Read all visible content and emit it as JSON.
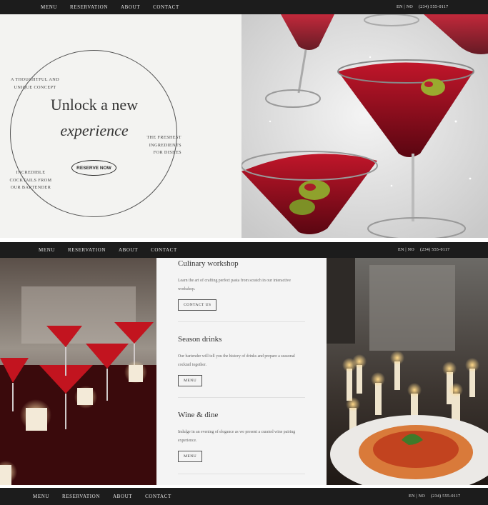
{
  "nav": {
    "items": [
      "MENU",
      "RESERVATION",
      "ABOUT",
      "CONTACT"
    ],
    "lang": "EN | NO",
    "phone": "(234) 555-0117"
  },
  "hero": {
    "title_line1": "Unlock a new",
    "title_line2": "experience",
    "concept_text": "A THOUGHTFUL AND UNIQUE CONCEPT",
    "ingredients_text": "THE FRESHEST INGREDIENTS FOR DISHES",
    "cocktails_text": "INCREDIBLE COCKTAILS FROM OUR BARTENDER",
    "reserve_label": "RESERVE NOW"
  },
  "services": [
    {
      "title": "Culinary workshop",
      "desc": "Learn the art of crafting perfect pasta from scratch in our interactive workshop.",
      "button": "CONTACT US"
    },
    {
      "title": "Season drinks",
      "desc": "Our bartender will tell you the history of drinks and prepare a seasonal cocktail together.",
      "button": "MENU"
    },
    {
      "title": "Wine & dine",
      "desc": "Indulge in an evening of elegance as we present a curated wine pairing experience.",
      "button": "MENU"
    }
  ],
  "colors": {
    "nav_bg": "#1c1c1c",
    "hero_bg": "#f3f3f1",
    "accent_red": "#8c0f1c"
  }
}
